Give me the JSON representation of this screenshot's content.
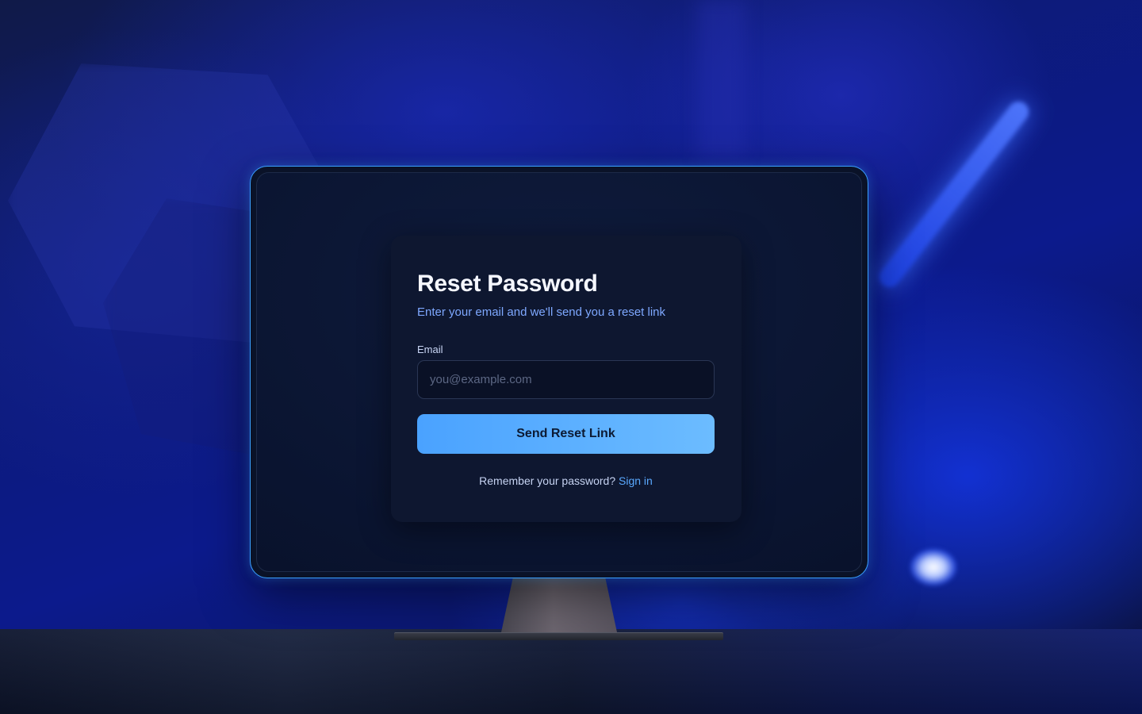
{
  "reset_form": {
    "title": "Reset Password",
    "subtitle": "Enter your email and we'll send you a reset link",
    "email_label": "Email",
    "email_placeholder": "you@example.com",
    "email_value": "",
    "submit_label": "Send Reset Link",
    "footer_prompt": "Remember your password?",
    "footer_link": "Sign in"
  },
  "colors": {
    "accent": "#4aa2ff",
    "link": "#5aa9ff",
    "card_background": "#0e1730",
    "monitor_border": "#3aa0ff"
  }
}
